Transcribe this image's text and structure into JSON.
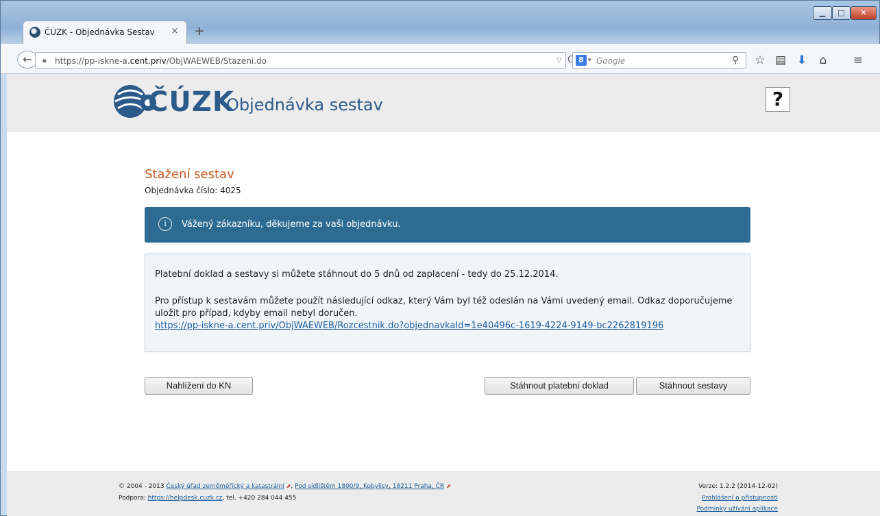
{
  "browser": {
    "tab_title": "ČÚZK - Objednávka Sestav",
    "tab_close": "×",
    "new_tab": "+",
    "url_prefix": "https://pp-iskne-a.",
    "url_host": "cent.priv",
    "url_path": "/ObjWAEWEB/Stazeni.do",
    "search_placeholder": "Google",
    "search_engine_glyph": "8"
  },
  "header": {
    "logo_text": "ČÚZK",
    "app_title": "Objednávka sestav",
    "help_label": "?"
  },
  "main": {
    "section_title": "Stažení sestav",
    "order_number": "Objednávka číslo: 4025",
    "alert_text": "Vážený zákazníku, děkujeme za vaši objednávku.",
    "info_p1": "Platební doklad a sestavy si můžete stáhnout do 5 dnů od zaplacení - tedy do 25.12.2014.",
    "info_p2": "Pro přístup k sestavám můžete použít následující odkaz, který Vám byl též odeslán na Vámi uvedený email. Odkaz doporučujeme uložit pro případ, kdyby email nebyl doručen.",
    "info_link": "https://pp-iskne-a.cent.priv/ObjWAEWEB/Rozcestnik.do?objednavkaId=1e40496c-1619-4224-9149-bc2262819196",
    "buttons": {
      "nahlizeni": "Nahlížení do KN",
      "platebni": "Stáhnout platební doklad",
      "sestavy": "Stáhnout sestavy"
    }
  },
  "footer": {
    "copyright": "© 2004 - 2013",
    "office_link": "Český úřad zeměměřický a katastrální",
    "address_link": "Pod sídlištěm 1800/9, Kobylisy, 18211 Praha, ČR",
    "support_label": "Podpora:",
    "support_link": "https://helpdesk.cuzk.cz",
    "support_phone": ", tel. +420 284 044 455",
    "version": "Verze: 1.2.2 (2014-12-02)",
    "accessibility_link": "Prohlášení o přístupnosti",
    "terms_link": "Podmínky užívání aplikace"
  },
  "icons": {
    "accent": "#2e6b92",
    "title_color": "#c6581e",
    "brand_color": "#2c5a8a"
  }
}
